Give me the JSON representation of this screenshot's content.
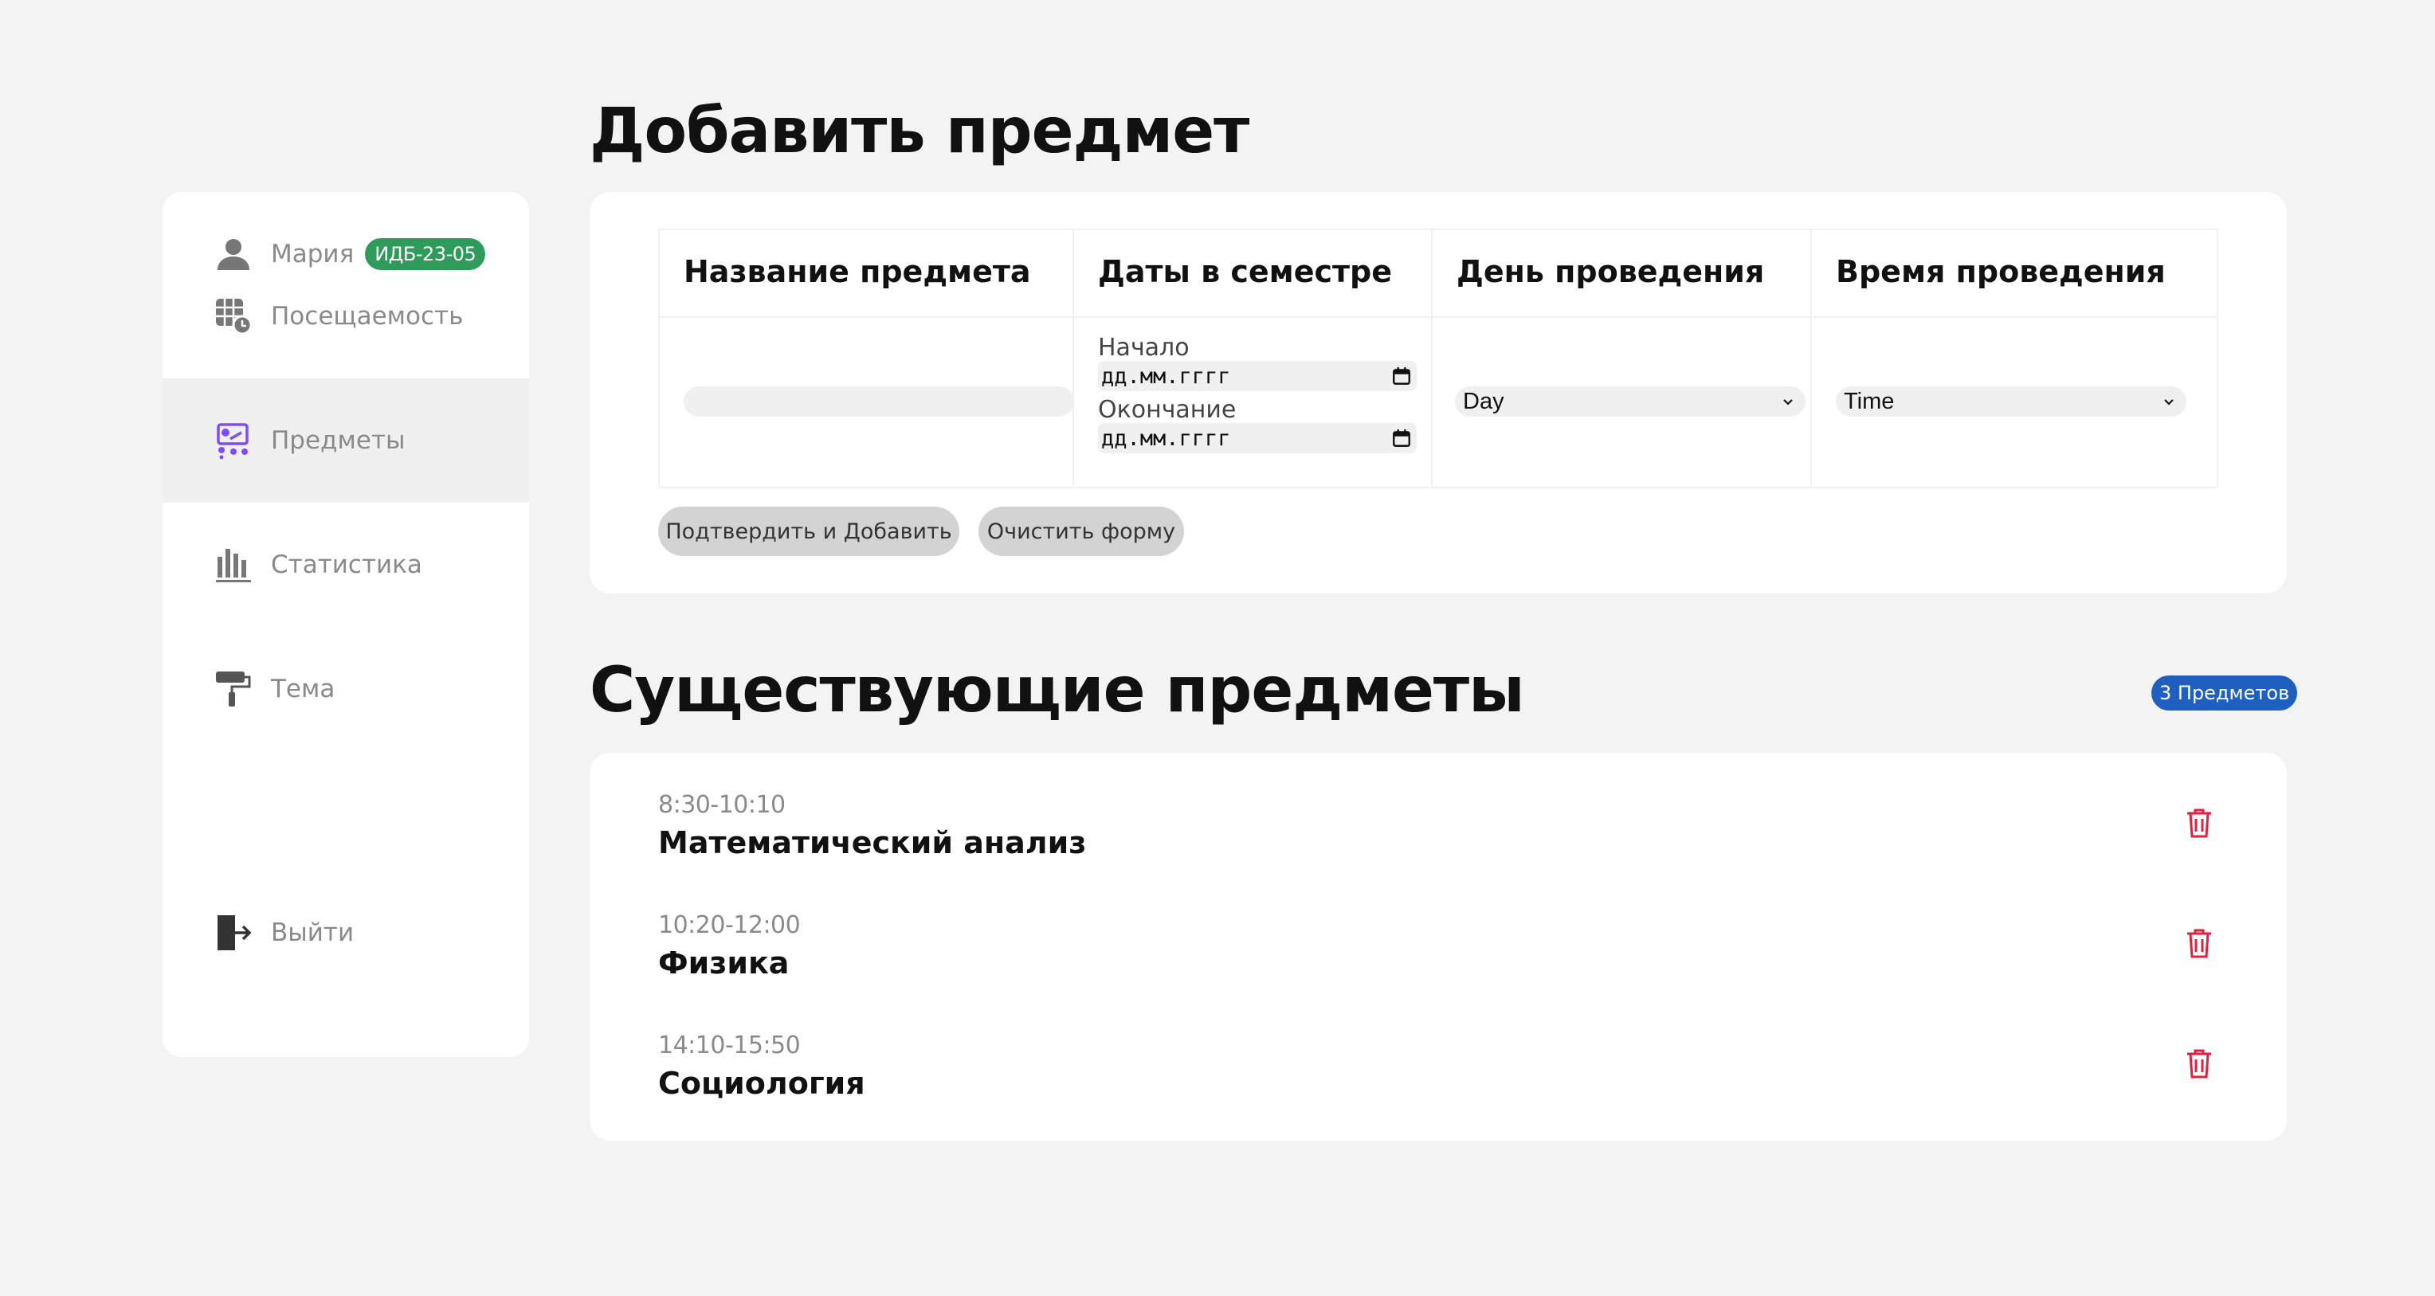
{
  "sidebar": {
    "user": {
      "name": "Мария",
      "group": "ИДБ-23-05",
      "icon": "user-icon"
    },
    "items": [
      {
        "label": "Посещаемость",
        "icon": "attendance-calendar-icon"
      },
      {
        "label": "Предметы",
        "icon": "subjects-presentation-icon",
        "active": true
      },
      {
        "label": "Статистика",
        "icon": "bar-chart-icon"
      },
      {
        "label": "Тема",
        "icon": "paint-roller-icon"
      }
    ],
    "logout": {
      "label": "Выйти",
      "icon": "logout-icon"
    }
  },
  "add_section": {
    "title": "Добавить предмет",
    "columns": [
      "Название предмета",
      "Даты в семестре",
      "День проведения",
      "Время проведения"
    ],
    "name_input": {
      "value": "",
      "placeholder": ""
    },
    "start_label": "Начало",
    "start_value": "дд.мм.гггг",
    "end_label": "Окончание",
    "end_value": "дд.мм.гггг",
    "day_select": "Day",
    "time_select": "Time",
    "confirm_button": "Подтвердить и Добавить",
    "clear_button": "Очистить форму"
  },
  "subjects_section": {
    "title": "Существующие предметы",
    "count_badge": "3 Предметов",
    "items": [
      {
        "time": "8:30-10:10",
        "name": "Математический анализ"
      },
      {
        "time": "10:20-12:00",
        "name": "Физика"
      },
      {
        "time": "14:10-15:50",
        "name": "Социология"
      }
    ]
  },
  "colors": {
    "background": "#f3f3f3",
    "group_badge": "#2e9b5b",
    "count_badge": "#1f5fbf",
    "active_icon": "#7c4dff",
    "delete": "#e0203c"
  }
}
